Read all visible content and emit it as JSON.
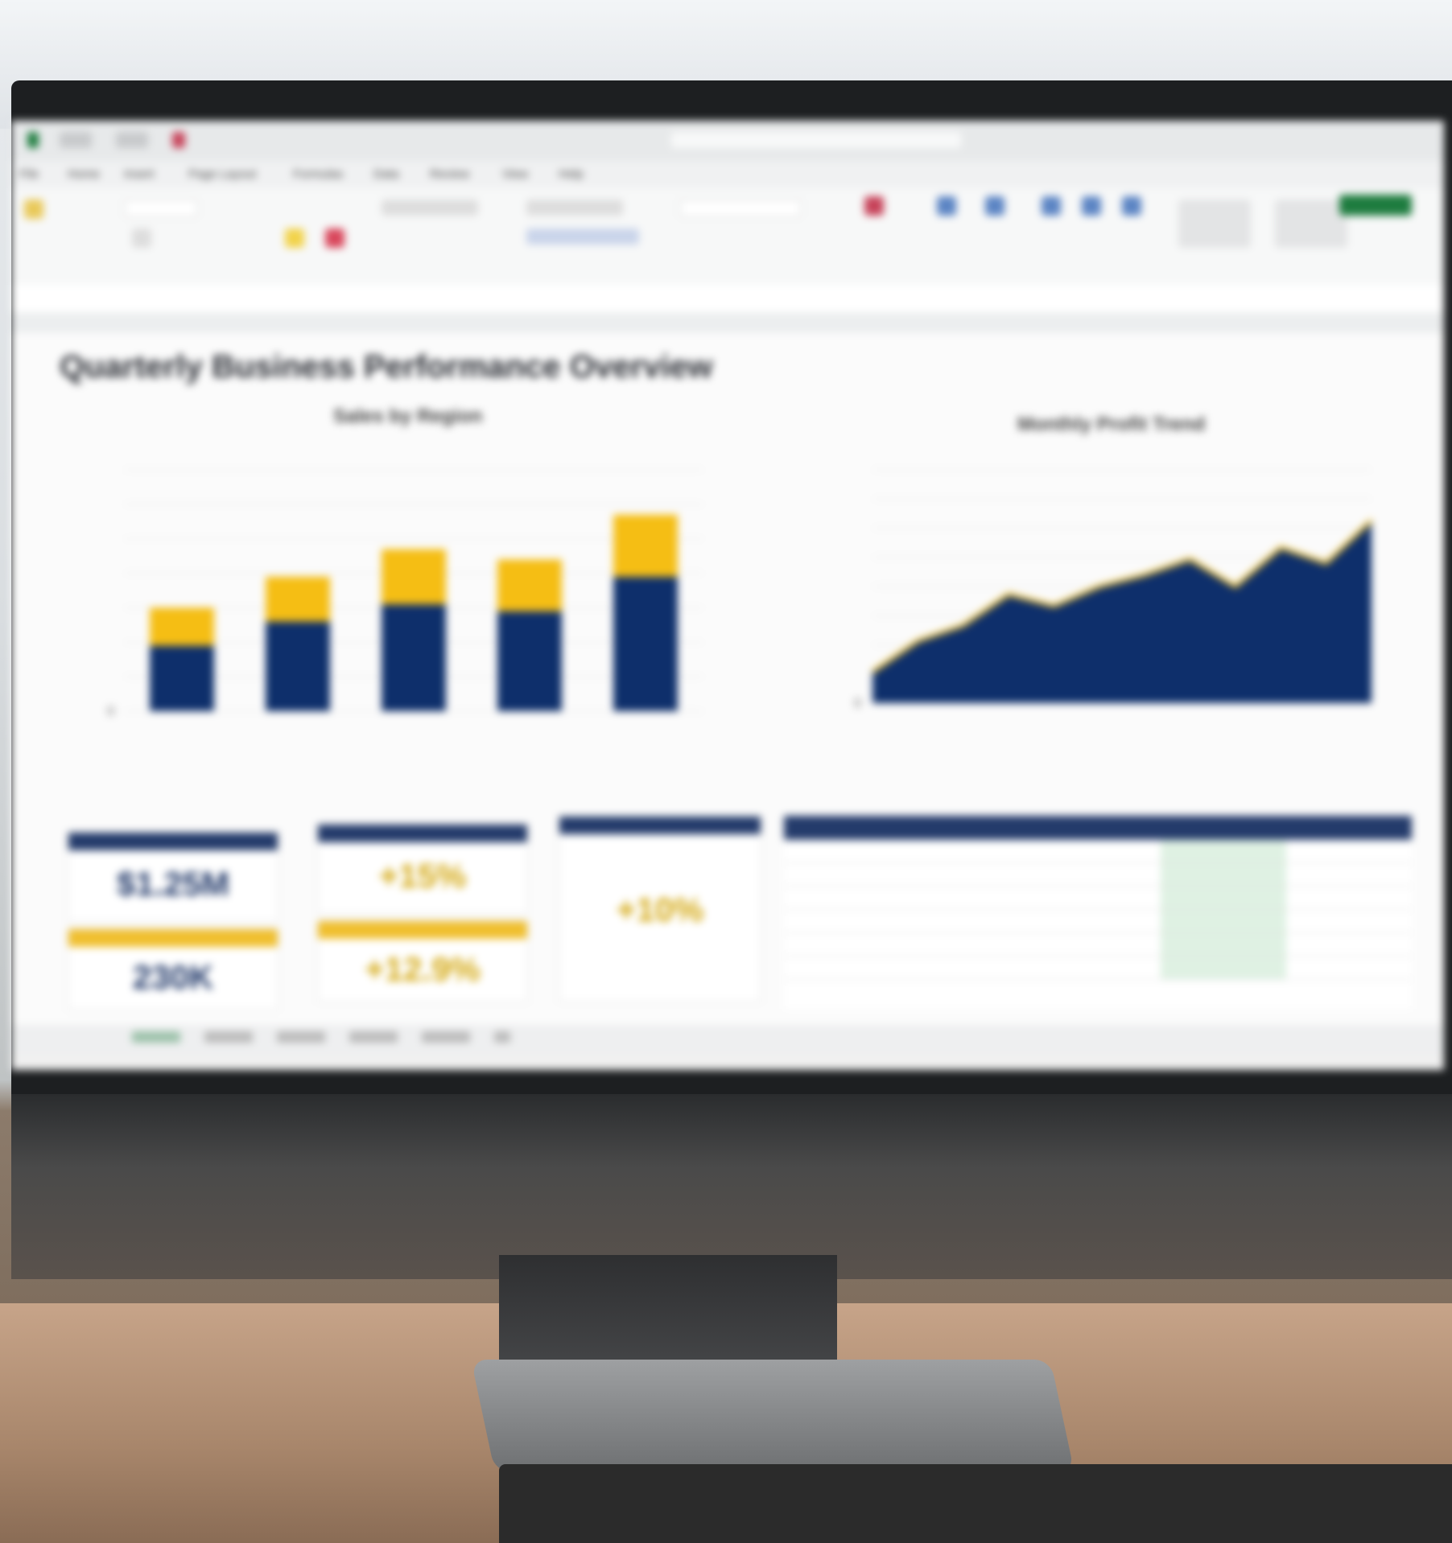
{
  "app": {
    "menu_items": [
      "File",
      "Home",
      "Insert",
      "Page Layout",
      "Formulas",
      "Data",
      "Review",
      "View",
      "Help"
    ]
  },
  "dashboard": {
    "title": "Quarterly Business Performance Overview",
    "left_chart_title": "Sales by Region",
    "right_chart_title": "Monthly Profit Trend"
  },
  "kpis": [
    {
      "value": "$1.25M",
      "color": "#243b6b"
    },
    {
      "value": "+15%",
      "color": "#d4a914"
    },
    {
      "value": "+10%",
      "color": "#d4a914"
    },
    {
      "value": "230K",
      "color": "#243b6b"
    },
    {
      "value": "+12.9%",
      "color": "#d4a914"
    }
  ],
  "colors": {
    "navy": "#0e2f6b",
    "gold": "#f5be14"
  },
  "chart_data": [
    {
      "type": "bar",
      "title": "Sales by Region",
      "categories": [
        "",
        "",
        "",
        "",
        ""
      ],
      "series": [
        {
          "values": [
            190,
            260,
            310,
            290,
            390
          ]
        },
        {
          "values": [
            110,
            130,
            160,
            150,
            180
          ]
        }
      ],
      "ylim": [
        0,
        700
      ],
      "yticks": [
        "0",
        "",
        "",
        "",
        "",
        "",
        "",
        ""
      ]
    },
    {
      "type": "area",
      "title": "Monthly Profit Trend",
      "x": [
        "",
        "",
        "",
        "",
        "",
        "",
        "",
        "",
        "",
        "",
        "",
        ""
      ],
      "series": [
        {
          "values": [
            80,
            160,
            200,
            280,
            250,
            300,
            330,
            370,
            300,
            400,
            360,
            470
          ]
        }
      ],
      "ylim": [
        0,
        600
      ],
      "yticks": [
        "0",
        "",
        "",
        "",
        "",
        "",
        "",
        "",
        ""
      ]
    }
  ]
}
